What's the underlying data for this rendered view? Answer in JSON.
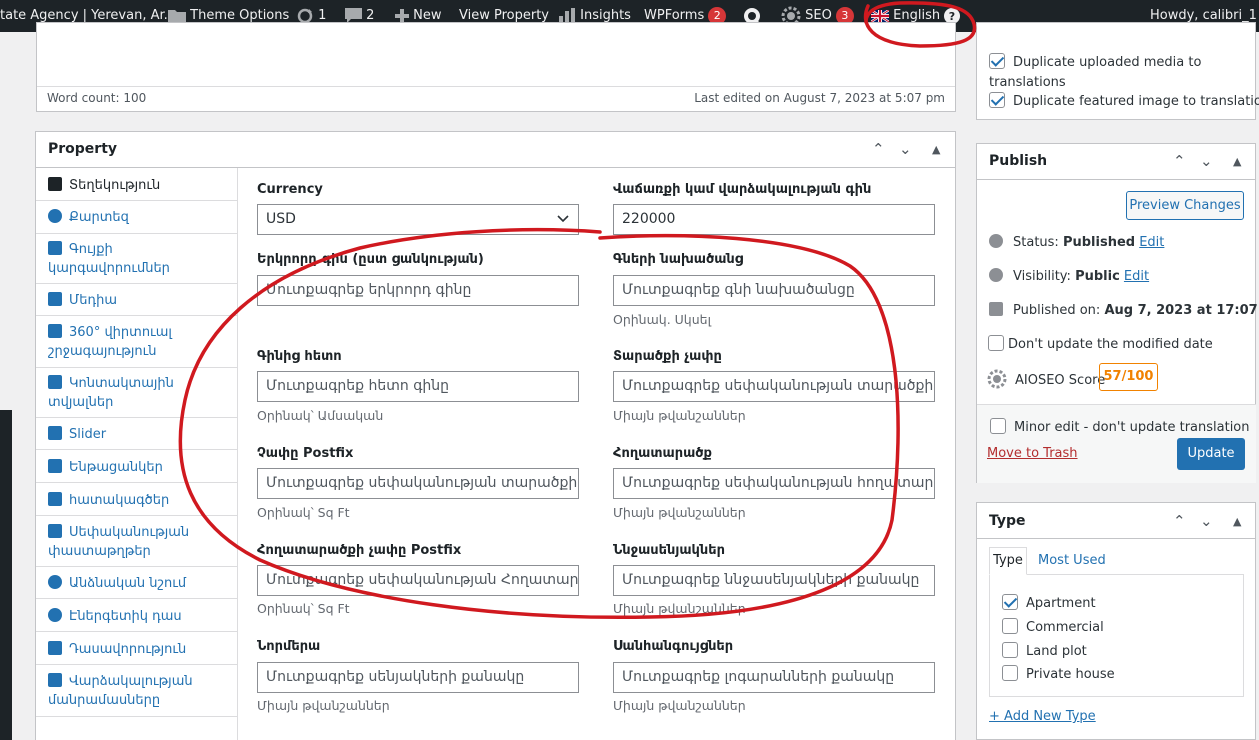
{
  "adminbar": {
    "site": "tate Agency | Yerevan, Ar...",
    "theme_options": "Theme Options",
    "updates_count": "1",
    "comments_count": "2",
    "new": "New",
    "view_property": "View Property",
    "insights": "Insights",
    "wpforms": "WPForms",
    "wpforms_badge": "2",
    "seo": "SEO",
    "seo_badge": "3",
    "language": "English",
    "howdy": "Howdy, calibri_1"
  },
  "editor": {
    "word_count": "Word count: 100",
    "last_edited": "Last edited on August 7, 2023 at 5:07 pm"
  },
  "property_box": {
    "title": "Property",
    "tabs": [
      {
        "label": "Տեղեկություն"
      },
      {
        "label": "Քարտեզ"
      },
      {
        "label": "Գույքի կարգավորումներ"
      },
      {
        "label": "Մեդիա"
      },
      {
        "label": "360° վիրտուալ շրջագայություն"
      },
      {
        "label": "Կոնտակտային տվյալներ"
      },
      {
        "label": "Slider"
      },
      {
        "label": "Ենթացանկեր"
      },
      {
        "label": "հատակագծեր"
      },
      {
        "label": "Սեփականության փաստաթղթեր"
      },
      {
        "label": "Անձնական նշում"
      },
      {
        "label": "Էներգետիկ դաս"
      },
      {
        "label": "Դասավորություն"
      },
      {
        "label": "Վարձակալության մանրամասները"
      }
    ],
    "fields": {
      "currency_label": "Currency",
      "currency_value": "USD",
      "price_label": "Վաճառքի կամ վարձակալության գին",
      "price_value": "220000",
      "second_price_label": "Երկրորդ գին (ըստ ցանկության)",
      "second_price_placeholder": "Մուտքագրեք երկրորդ գինը",
      "price_prefix_label": "Գների նախածանց",
      "price_prefix_placeholder": "Մուտքագրեք գնի նախածանցը",
      "price_prefix_help": "Օրինակ. Սկսել",
      "after_price_label": "Գինից հետո",
      "after_price_placeholder": "Մուտքագրեք հետո գինը",
      "after_price_help": "Օրինակ՝ Ամսական",
      "area_size_label": "Տարածքի չափը",
      "area_size_placeholder": "Մուտքագրեք սեփականության տարածքի չափը",
      "area_size_help": "Միայն թվանշաններ",
      "size_postfix_label": "Չափը Postfix",
      "size_postfix_placeholder": "Մուտքագրեք սեփականության տարածքի չափը",
      "size_postfix_help": "Օրինակ՝ Sq Ft",
      "land_area_label": "Հողատարածք",
      "land_area_placeholder": "Մուտքագրեք սեփականության հողատարածքը",
      "land_area_help": "Միայն թվանշաններ",
      "land_postfix_label": "Հողատարածքի չափը Postfix",
      "land_postfix_placeholder": "Մուտքագրեք սեփականության Հողատարածքի",
      "land_postfix_help": "Օրինակ՝ Sq Ft",
      "bedrooms_label": "Ննջասենյակներ",
      "bedrooms_placeholder": "Մուտքագրեք ննջասենյակների քանակը",
      "bedrooms_help": "Միայն թվանշաններ",
      "rooms_label": "Նորմերա",
      "rooms_placeholder": "Մուտքագրեք սենյակների քանակը",
      "rooms_help": "Միայն թվանշաններ",
      "bathrooms_label": "Սանհանգույցներ",
      "bathrooms_placeholder": "Մուտքագրեք լոգարանների քանակը",
      "bathrooms_help": "Միայն թվանշաններ"
    }
  },
  "translation_box": {
    "dup_media": "Duplicate uploaded media to translations",
    "dup_featured": "Duplicate featured image to translations"
  },
  "publish": {
    "title": "Publish",
    "preview": "Preview Changes",
    "status_label": "Status:",
    "status_value": "Published",
    "visibility_label": "Visibility:",
    "visibility_value": "Public",
    "published_label": "Published on:",
    "published_value": "Aug 7, 2023 at 17:07",
    "edit": "Edit",
    "dont_update": "Don't update the modified date",
    "aioseo_label": "AIOSEO Score",
    "aioseo_score": "57/100",
    "minor_edit": "Minor edit - don't update translation",
    "trash": "Move to Trash",
    "update": "Update"
  },
  "type_box": {
    "title": "Type",
    "tab_type": "Type",
    "tab_used": "Most Used",
    "options": [
      "Apartment",
      "Commercial",
      "Land plot",
      "Private house"
    ],
    "add_new": "+ Add New Type"
  },
  "colors": {
    "adminbar": "#1d2327",
    "accent": "#2271b1",
    "annotation": "#d0191f",
    "aioseo_score": "#f18200"
  }
}
